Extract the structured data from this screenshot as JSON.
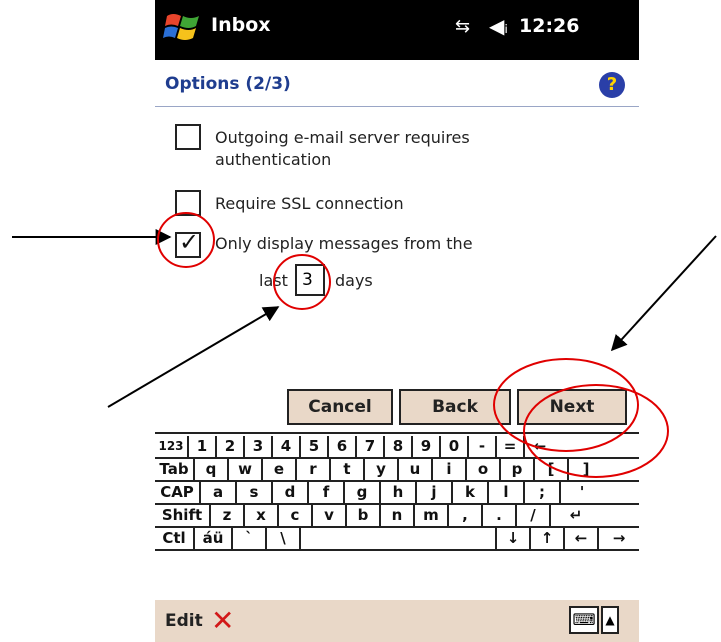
{
  "titlebar": {
    "app_title": "Inbox",
    "clock": "12:26",
    "connectivity_icon": "connectivity-icon",
    "volume_icon": "speaker-icon"
  },
  "header": {
    "title": "Options (2/3)",
    "help_glyph": "?"
  },
  "options": [
    {
      "label": "Outgoing e-mail server requires authentication",
      "checked": false
    },
    {
      "label": "Require SSL connection",
      "checked": false
    },
    {
      "label": "Only display messages from the",
      "checked": true
    }
  ],
  "days": {
    "prefix": "last",
    "value": "3",
    "suffix": "days"
  },
  "buttons": {
    "cancel": "Cancel",
    "back": "Back",
    "next": "Next"
  },
  "keyboard": {
    "row1": [
      "123",
      "1",
      "2",
      "3",
      "4",
      "5",
      "6",
      "7",
      "8",
      "9",
      "0",
      "-",
      "=",
      "←"
    ],
    "row2": [
      "Tab",
      "q",
      "w",
      "e",
      "r",
      "t",
      "y",
      "u",
      "i",
      "o",
      "p",
      "[",
      "]"
    ],
    "row3": [
      "CAP",
      "a",
      "s",
      "d",
      "f",
      "g",
      "h",
      "j",
      "k",
      "l",
      ";",
      "'"
    ],
    "row4": [
      "Shift",
      "z",
      "x",
      "c",
      "v",
      "b",
      "n",
      "m",
      ",",
      ".",
      "/",
      "↵"
    ],
    "row5": [
      "Ctl",
      "áü",
      "`",
      "\\",
      "",
      "↓",
      "↑",
      "←",
      "→"
    ]
  },
  "bottom": {
    "edit": "Edit",
    "close_glyph": "✕",
    "keyboard_glyph": "⌨",
    "arrow_glyph": "▲"
  },
  "colors": {
    "titlebar_bg": "#000000",
    "header_text": "#1f3d8f",
    "button_bg": "#e9d8c8",
    "annotation_red": "#e00000"
  }
}
